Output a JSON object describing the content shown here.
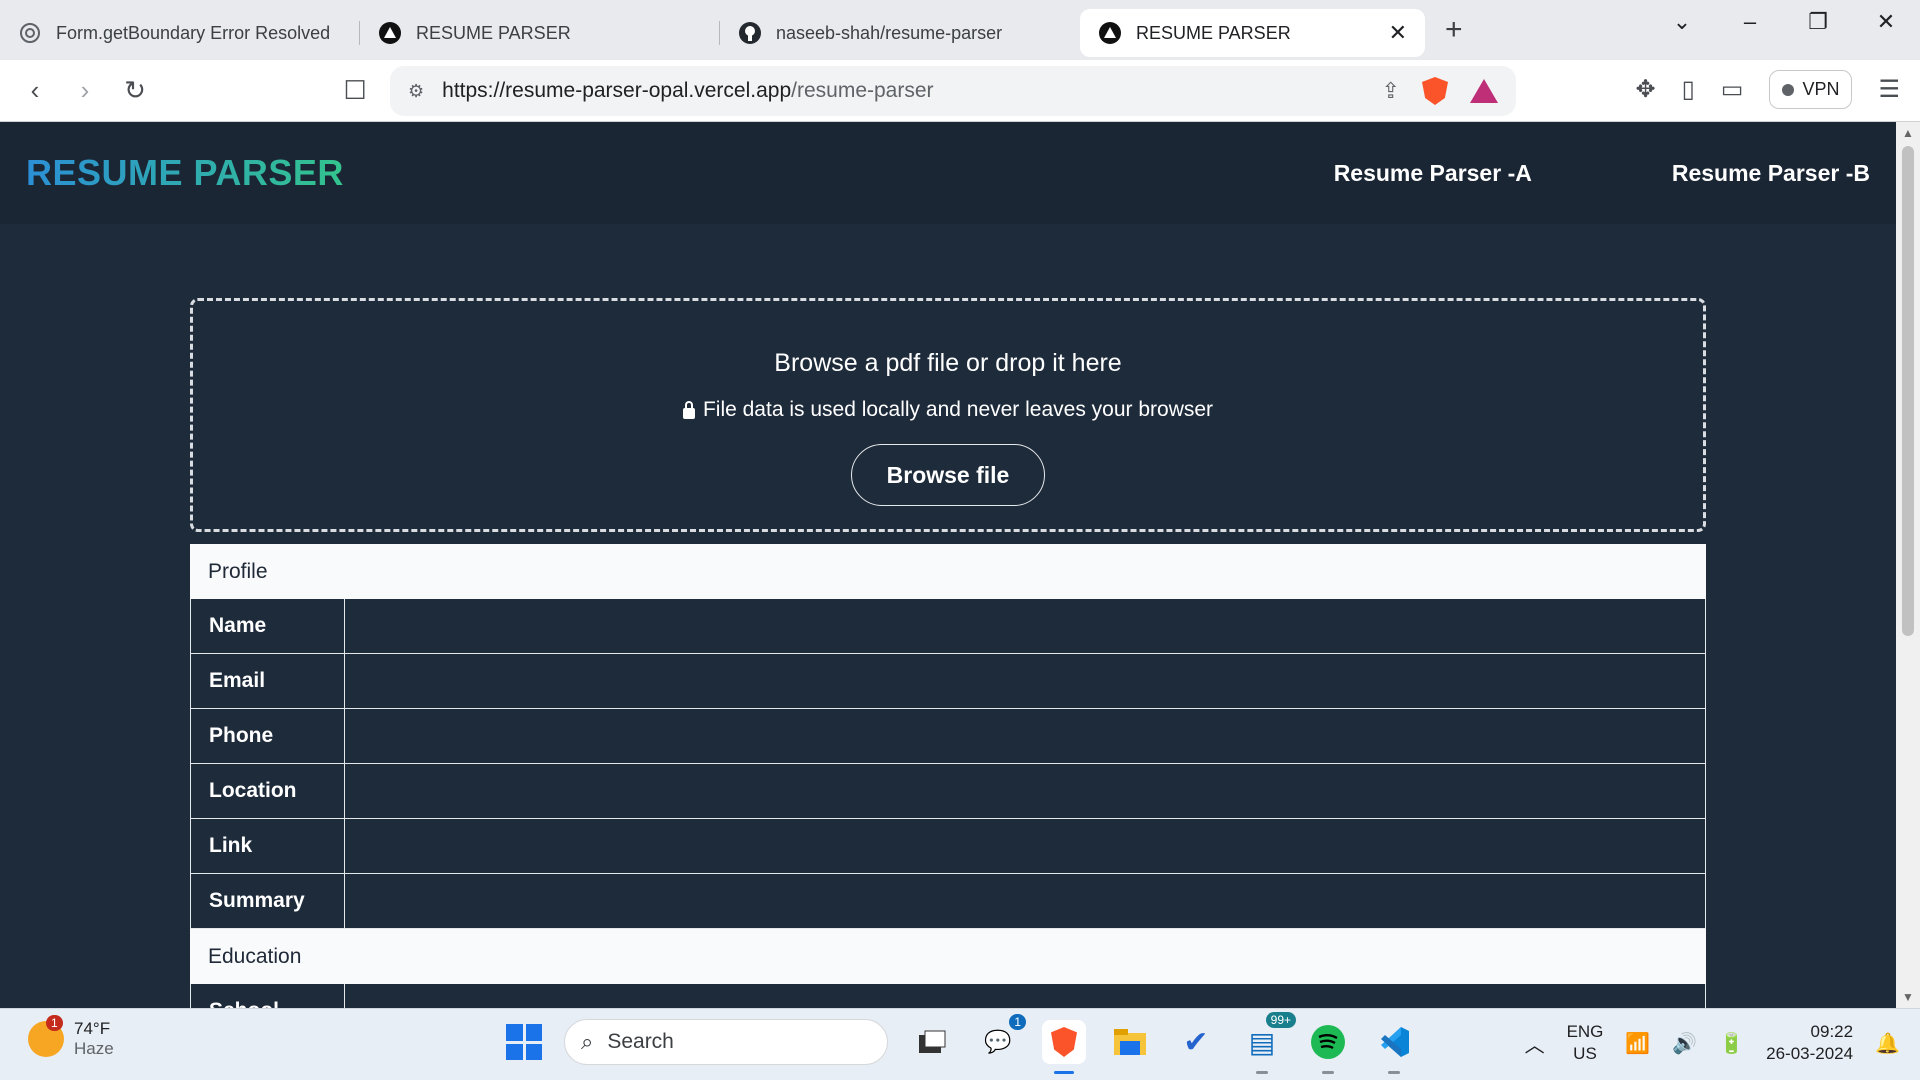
{
  "browser": {
    "tabs": [
      {
        "title": "Form.getBoundary Error Resolved",
        "icon": "chatgpt-icon"
      },
      {
        "title": "RESUME PARSER",
        "icon": "vercel-triangle-icon"
      },
      {
        "title": "naseeb-shah/resume-parser",
        "icon": "github-icon"
      },
      {
        "title": "RESUME PARSER",
        "icon": "vercel-triangle-icon",
        "active": true
      }
    ],
    "new_tab_label": "+",
    "url_host": "https://resume-parser-opal.vercel.app",
    "url_path": "/resume-parser",
    "vpn_label": "VPN"
  },
  "site": {
    "logo": "RESUME PARSER",
    "nav": [
      "Resume Parser -A",
      "Resume Parser -B"
    ]
  },
  "dropzone": {
    "title": "Browse a pdf file or drop it here",
    "note": "File data is used locally and never leaves your browser",
    "button": "Browse file"
  },
  "table": {
    "profile_header": "Profile",
    "fields": [
      "Name",
      "Email",
      "Phone",
      "Location",
      "Link",
      "Summary"
    ],
    "education_header": "Education",
    "education_fields": [
      "School"
    ]
  },
  "taskbar": {
    "weather_temp": "74°F",
    "weather_desc": "Haze",
    "weather_badge": "1",
    "search_placeholder": "Search",
    "teams_badge": "1",
    "mail_badge": "99+",
    "lang_1": "ENG",
    "lang_2": "US",
    "time": "09:22",
    "date": "26-03-2024"
  },
  "colors": {
    "page_bg": "#1e2b3b",
    "nav_bg": "#1b2634",
    "logo_gradient_start": "#2b8fd6",
    "logo_gradient_end": "#33c48d"
  }
}
